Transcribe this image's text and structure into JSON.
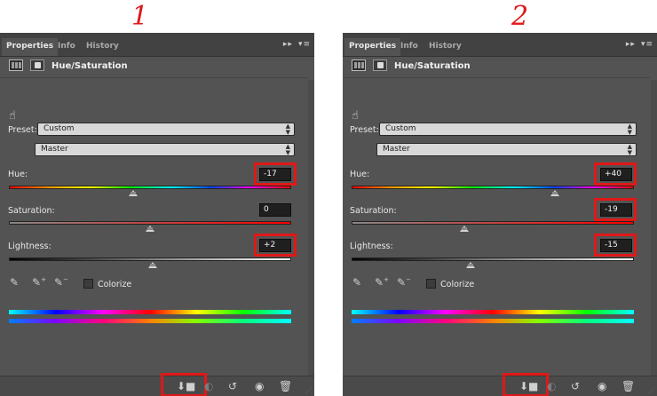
{
  "panels": [
    {
      "number": "1",
      "tabs": [
        "Properties",
        "Info",
        "History"
      ],
      "title": "Hue/Saturation",
      "preset_label": "Preset:",
      "preset_value": "Custom",
      "channel_value": "Master",
      "hue_label": "Hue:",
      "hue_value": "-17",
      "hue_level": 0.44,
      "saturation_label": "Saturation:",
      "saturation_value": "0",
      "saturation_level": 0.5,
      "lightness_label": "Lightness:",
      "lightness_value": "+2",
      "lightness_level": 0.51,
      "colorize_label": "Colorize",
      "highlights": [
        "hue",
        "lightness",
        "clip"
      ]
    },
    {
      "number": "2",
      "tabs": [
        "Properties",
        "Info",
        "History"
      ],
      "title": "Hue/Saturation",
      "preset_label": "Preset:",
      "preset_value": "Custom",
      "channel_value": "Master",
      "hue_label": "Hue:",
      "hue_value": "+40",
      "hue_level": 0.72,
      "saturation_label": "Saturation:",
      "saturation_value": "-19",
      "saturation_level": 0.4,
      "lightness_label": "Lightness:",
      "lightness_value": "-15",
      "lightness_level": 0.42,
      "colorize_label": "Colorize",
      "highlights": [
        "hue",
        "saturation",
        "lightness",
        "clip"
      ]
    }
  ],
  "colors": {
    "highlight": "#e01818",
    "panel": "#535353",
    "tabbar": "#424242"
  },
  "icons": [
    "expand-arrows-icon",
    "panel-menu-icon",
    "adjustment-layer-icon",
    "mask-icon",
    "targeted-adjust-hand-icon",
    "eyedropper-icon",
    "eyedropper-add-icon",
    "eyedropper-subtract-icon",
    "clip-to-layer-icon",
    "view-previous-icon",
    "reset-icon",
    "visibility-eye-icon",
    "trash-icon"
  ]
}
